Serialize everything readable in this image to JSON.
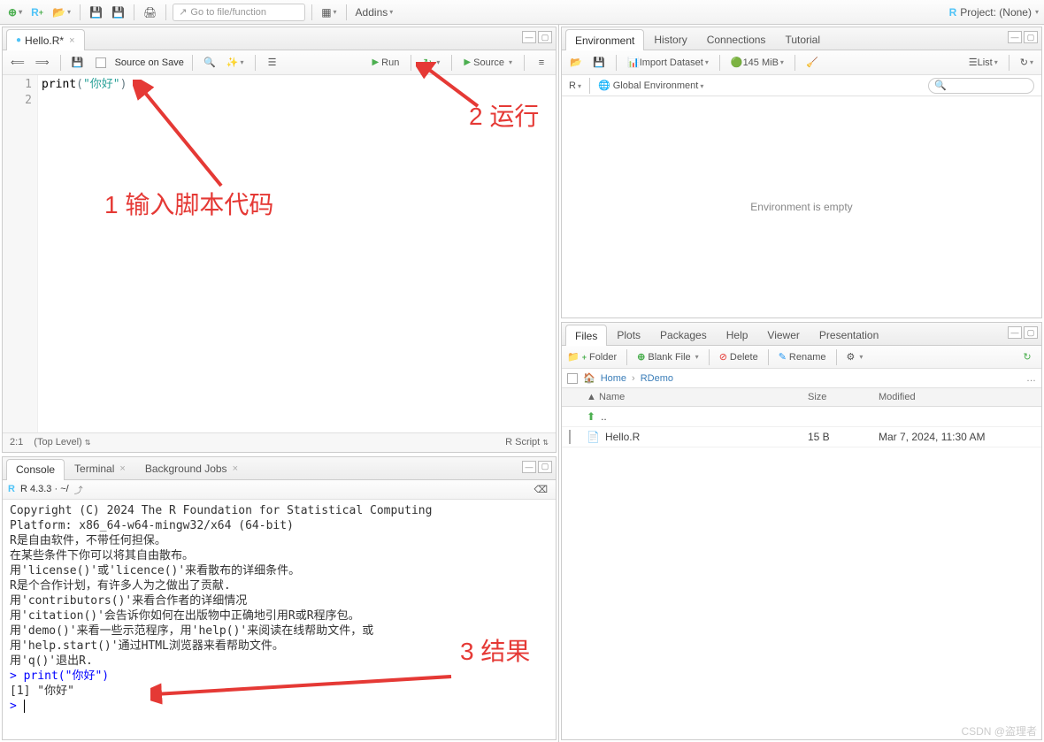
{
  "main_toolbar": {
    "goto_placeholder": "Go to file/function",
    "addins_label": "Addins",
    "project_label": "Project: (None)"
  },
  "source": {
    "file_tab": "Hello.R*",
    "source_on_save": "Source on Save",
    "run_label": "Run",
    "source_label": "Source",
    "code": {
      "line1_fn": "print",
      "line1_str": "\"你好\"",
      "gutter": [
        "1",
        "2"
      ]
    },
    "status": {
      "pos": "2:1",
      "scope": "(Top Level)",
      "lang": "R Script"
    }
  },
  "console": {
    "tabs": [
      "Console",
      "Terminal",
      "Background Jobs"
    ],
    "header": "R 4.3.3 · ~/",
    "lines": [
      "Copyright (C) 2024 The R Foundation for Statistical Computing",
      "Platform: x86_64-w64-mingw32/x64 (64-bit)",
      "",
      "R是自由软件，不带任何担保。",
      "在某些条件下你可以将其自由散布。",
      "用'license()'或'licence()'来看散布的详细条件。",
      "",
      "R是个合作计划，有许多人为之做出了贡献.",
      "用'contributors()'来看合作者的详细情况",
      "用'citation()'会告诉你如何在出版物中正确地引用R或R程序包。",
      "",
      "用'demo()'来看一些示范程序，用'help()'来阅读在线帮助文件，或",
      "用'help.start()'通过HTML浏览器来看帮助文件。",
      "用'q()'退出R.",
      ""
    ],
    "cmd_prompt": "> ",
    "cmd_text": "print(\"你好\")",
    "result": "[1] \"你好\"",
    "final_prompt": "> "
  },
  "env": {
    "tabs": [
      "Environment",
      "History",
      "Connections",
      "Tutorial"
    ],
    "import_label": "Import Dataset",
    "memory": "145 MiB",
    "list_label": "List",
    "scope_r": "R",
    "scope_env": "Global Environment",
    "empty_msg": "Environment is empty"
  },
  "files": {
    "tabs": [
      "Files",
      "Plots",
      "Packages",
      "Help",
      "Viewer",
      "Presentation"
    ],
    "new_folder": "Folder",
    "blank_file": "Blank File",
    "delete": "Delete",
    "rename": "Rename",
    "breadcrumb": [
      "Home",
      "RDemo"
    ],
    "cols": [
      "Name",
      "Size",
      "Modified"
    ],
    "rows": [
      {
        "name": "..",
        "size": "",
        "modified": "",
        "icon": "up"
      },
      {
        "name": "Hello.R",
        "size": "15 B",
        "modified": "Mar 7, 2024, 11:30 AM",
        "icon": "rfile"
      }
    ]
  },
  "annotations": {
    "a1": "1 输入脚本代码",
    "a2": "2 运行",
    "a3": "3 结果"
  },
  "watermark": "CSDN @盗理者"
}
